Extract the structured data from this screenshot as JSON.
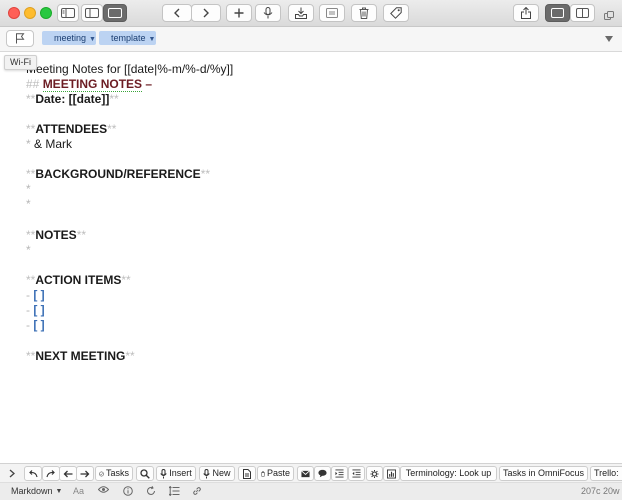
{
  "tooltip": "Wi-Fi",
  "tags": [
    {
      "label": "meeting"
    },
    {
      "label": "template"
    }
  ],
  "document": {
    "title_prefix": "Meeting Notes for  ",
    "title_date": "[[date|%-m/%-d/%y]]",
    "heading_marker": "## ",
    "heading_text": "MEETING NOTES",
    "heading_tail": " –",
    "bold_marker": "**",
    "date_line": "Date: [[date]]",
    "attendees": "ATTENDEES",
    "bullet": "*",
    "attendee_item": " & Mark",
    "background": "BACKGROUND/REFERENCE",
    "notes": "NOTES",
    "action_items": "ACTION ITEMS",
    "dash": "- ",
    "checkbox": "[   ]",
    "next_meeting": "NEXT MEETING"
  },
  "toolbar": {
    "tasks": "Tasks",
    "insert": "Insert",
    "new": "New",
    "paste": "Paste",
    "terminology": "Terminology: Look up",
    "tasks_omnifocus": "Tasks in OmniFocus",
    "trello": "Trello:"
  },
  "statusbar": {
    "mode": "Markdown",
    "font_toggle": "Aa",
    "counts": "207c 20w"
  },
  "colors": {
    "heading": "#6c1c23",
    "todo": "#3b6fb5",
    "tag_bg": "#bcd3f2"
  }
}
